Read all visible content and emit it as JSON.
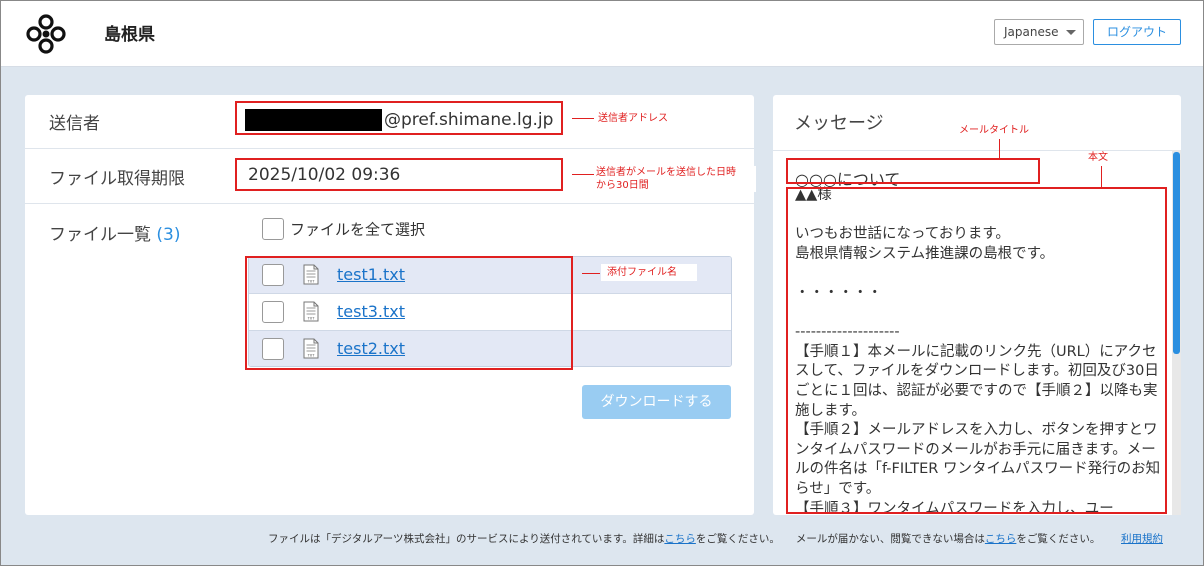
{
  "header": {
    "org_name": "島根県",
    "language": "Japanese",
    "logout_label": "ログアウト"
  },
  "sender": {
    "label": "送信者",
    "email_domain": "@pref.shimane.lg.jp"
  },
  "expiry": {
    "label": "ファイル取得期限",
    "value": "2025/10/02 09:36"
  },
  "files": {
    "label": "ファイル一覧",
    "count": "(3)",
    "select_all_label": "ファイルを全て選択",
    "items": [
      {
        "name": "test1.txt"
      },
      {
        "name": "test3.txt"
      },
      {
        "name": "test2.txt"
      }
    ],
    "download_label": "ダウンロードする"
  },
  "message": {
    "header": "メッセージ",
    "subject": "○○○について",
    "body": "▲▲様\n\nいつもお世話になっております。\n島根県情報システム推進課の島根です。\n\n・・・・・・\n\n--------------------\n【手順１】本メールに記載のリンク先（URL）にアクセスして、ファイルをダウンロードします。初回及び30日ごとに１回は、認証が必要ですので【手順２】以降も実施します。\n【手順２】メールアドレスを入力し、ボタンを押すとワンタイムパスワードのメールがお手元に届きます。メールの件名は「f-FILTER ワンタイムパスワード発行のお知らせ」です。\n【手順３】ワンタイムパスワードを入力し、ユー"
  },
  "annotations": {
    "sender_address": "送信者アドレス",
    "expiry_note_line1": "送信者がメールを送信した日時",
    "expiry_note_line2": "から30日間",
    "attachment_name": "添付ファイル名",
    "mail_title": "メールタイトル",
    "body_text": "本文"
  },
  "footer": {
    "text_part1": "ファイルは「デジタルアーツ株式会社」のサービスにより送付されています。詳細は",
    "link1": "こちら",
    "text_part2": "をご覧ください。",
    "text_part3": "メールが届かない、閲覧できない場合は",
    "link2": "こちら",
    "text_part4": "をご覧ください。",
    "terms": "利用規約"
  },
  "colors": {
    "accent": "#2b8fe0",
    "link": "#1a73c9",
    "annotation": "#e02020",
    "page_bg": "#dde6ef",
    "file_row_shade": "#e3e8f5",
    "download_disabled": "#99ccf2"
  }
}
